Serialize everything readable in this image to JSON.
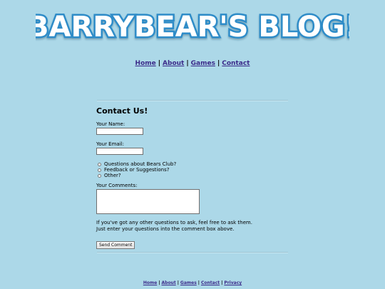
{
  "site": {
    "logo_text": "BARRYBEAR'S BLOG!"
  },
  "top_nav": [
    {
      "label": "Home"
    },
    {
      "label": "About"
    },
    {
      "label": "Games"
    },
    {
      "label": "Contact"
    }
  ],
  "contact": {
    "title": "Contact Us!",
    "name_label": "Your Name:",
    "name_value": "",
    "email_label": "Your Email:",
    "email_value": "",
    "radio_options": [
      {
        "label": "Questions about Bears Club?",
        "checked": false
      },
      {
        "label": "Feedback or Suggestions?",
        "checked": false
      },
      {
        "label": "Other?",
        "checked": false
      }
    ],
    "comments_label": "Your Comments:",
    "comments_value": "",
    "info_line_1": "If you've got any other questions to ask, feel free to ask them.",
    "info_line_2": "Just enter your questions into the comment box above.",
    "submit_label": "Send Comment"
  },
  "footer_nav": [
    {
      "label": "Home"
    },
    {
      "label": "About"
    },
    {
      "label": "Games"
    },
    {
      "label": "Contact"
    },
    {
      "label": "Privacy"
    }
  ],
  "colors": {
    "background": "#acd8e8",
    "logo_fill": "#ffffff",
    "logo_stroke": "#2f8cc8",
    "link": "#3b2b8a"
  }
}
